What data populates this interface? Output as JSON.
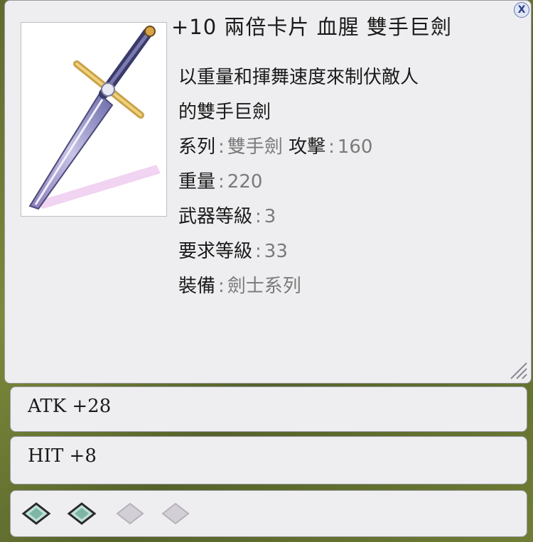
{
  "item": {
    "title": "+10 兩倍卡片 血腥 雙手巨劍",
    "description_lines": [
      "以重量和揮舞速度來制伏敵人",
      "的雙手巨劍"
    ],
    "stats": [
      {
        "label": "系列",
        "value": "雙手劍",
        "extra_label": "攻擊",
        "extra_value": "160"
      },
      {
        "label": "重量",
        "value": "220"
      },
      {
        "label": "武器等級",
        "value": "3"
      },
      {
        "label": "要求等級",
        "value": "33"
      },
      {
        "label": "裝備",
        "value": "劍士系列"
      }
    ],
    "separator": ":",
    "icon": "two-handed-sword-icon",
    "close_glyph": "X"
  },
  "bonuses": {
    "atk": "ATK +28",
    "hit": "HIT +8"
  },
  "card_slots": [
    {
      "state": "filled",
      "icon": "card-icon"
    },
    {
      "state": "filled",
      "icon": "card-icon"
    },
    {
      "state": "empty",
      "icon": "empty-slot-icon"
    },
    {
      "state": "empty",
      "icon": "empty-slot-icon"
    }
  ]
}
